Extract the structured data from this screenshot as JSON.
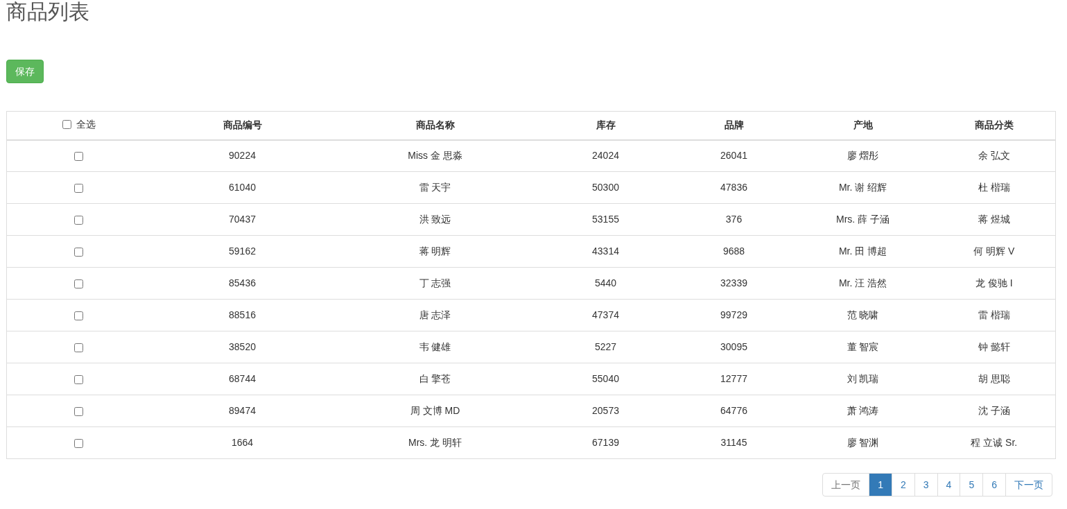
{
  "title": "商品列表",
  "save_button": "保存",
  "table": {
    "select_all": {
      "label": "全选",
      "checked": false
    },
    "columns": [
      "商品编号",
      "商品名称",
      "库存",
      "品牌",
      "产地",
      "商品分类"
    ],
    "rows": [
      {
        "checked": false,
        "cells": [
          "90224",
          "Miss 金 思淼",
          "24024",
          "26041",
          "廖 熠彤",
          "余 弘文"
        ]
      },
      {
        "checked": false,
        "cells": [
          "61040",
          "雷 天宇",
          "50300",
          "47836",
          "Mr. 谢 绍辉",
          "杜 楷瑞"
        ]
      },
      {
        "checked": false,
        "cells": [
          "70437",
          "洪 致远",
          "53155",
          "376",
          "Mrs. 薛 子涵",
          "蒋 煜城"
        ]
      },
      {
        "checked": false,
        "cells": [
          "59162",
          "蒋 明辉",
          "43314",
          "9688",
          "Mr. 田 博超",
          "何 明辉 V"
        ]
      },
      {
        "checked": false,
        "cells": [
          "85436",
          "丁 志强",
          "5440",
          "32339",
          "Mr. 汪 浩然",
          "龙 俊驰 I"
        ]
      },
      {
        "checked": false,
        "cells": [
          "88516",
          "唐 志泽",
          "47374",
          "99729",
          "范 晓啸",
          "雷 楷瑞"
        ]
      },
      {
        "checked": false,
        "cells": [
          "38520",
          "韦 健雄",
          "5227",
          "30095",
          "董 智宸",
          "钟 懿轩"
        ]
      },
      {
        "checked": false,
        "cells": [
          "68744",
          "白 擎苍",
          "55040",
          "12777",
          "刘 凯瑞",
          "胡 思聪"
        ]
      },
      {
        "checked": false,
        "cells": [
          "89474",
          "周 文博 MD",
          "20573",
          "64776",
          "萧 鸿涛",
          "沈 子涵"
        ]
      },
      {
        "checked": false,
        "cells": [
          "1664",
          "Mrs. 龙 明轩",
          "67139",
          "31145",
          "廖 智渊",
          "程 立诚 Sr."
        ]
      }
    ]
  },
  "pagination": {
    "prev": {
      "label": "上一页",
      "disabled": true
    },
    "pages": [
      {
        "label": "1",
        "selected": true
      },
      {
        "label": "2",
        "selected": false
      },
      {
        "label": "3",
        "selected": false
      },
      {
        "label": "4",
        "selected": false
      },
      {
        "label": "5",
        "selected": false
      },
      {
        "label": "6",
        "selected": false
      }
    ],
    "next": {
      "label": "下一页",
      "disabled": false
    }
  }
}
